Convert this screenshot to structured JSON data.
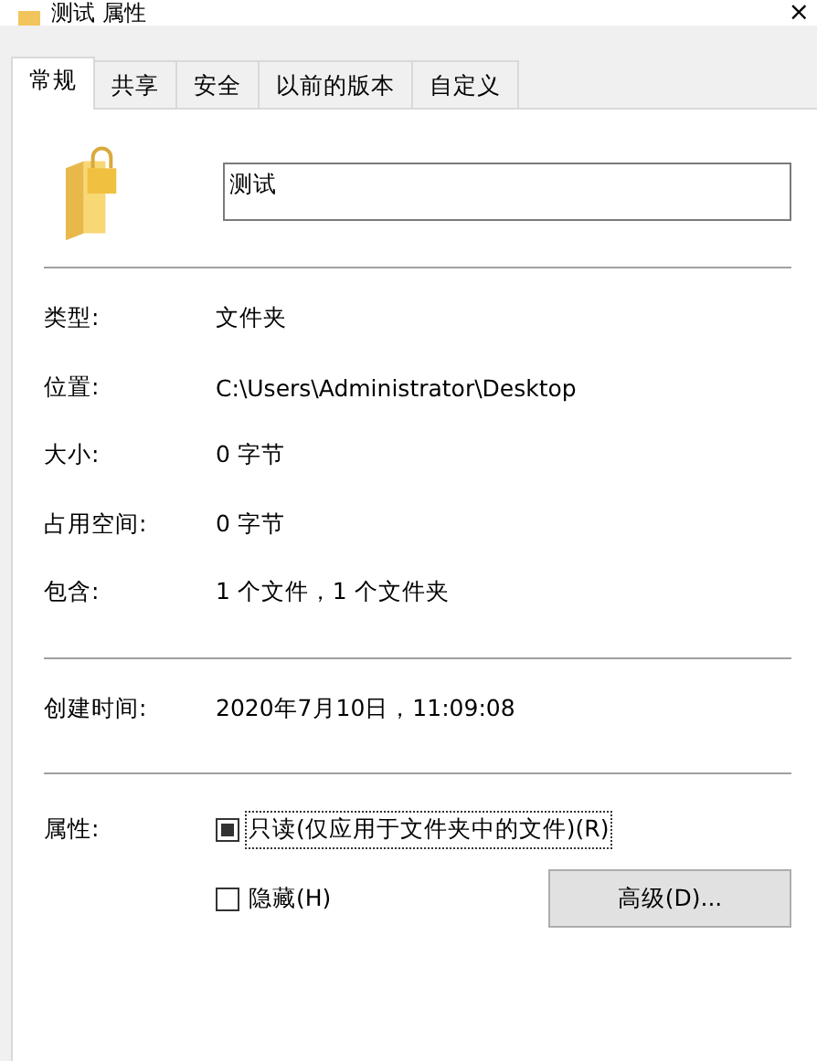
{
  "window": {
    "title": "测试 属性",
    "close": "×"
  },
  "tabs": [
    {
      "label": "常规",
      "selected": true
    },
    {
      "label": "共享",
      "selected": false
    },
    {
      "label": "安全",
      "selected": false
    },
    {
      "label": "以前的版本",
      "selected": false
    },
    {
      "label": "自定义",
      "selected": false
    }
  ],
  "name_field": {
    "value": "测试"
  },
  "info_groups": [
    [
      {
        "label": "类型:",
        "value": "文件夹"
      },
      {
        "label": "位置:",
        "value": "C:\\Users\\Administrator\\Desktop"
      },
      {
        "label": "大小:",
        "value": "0 字节"
      },
      {
        "label": "占用空间:",
        "value": "0 字节"
      },
      {
        "label": "包含:",
        "value": "1 个文件，1 个文件夹"
      }
    ],
    [
      {
        "label": "创建时间:",
        "value": "2020年7月10日，11:09:08"
      }
    ]
  ],
  "attributes": {
    "label": "属性:",
    "checkboxes": [
      {
        "label": "只读(仅应用于文件夹中的文件)(R)",
        "indeterminate": true,
        "focused": true
      },
      {
        "label": "隐藏(H)",
        "indeterminate": false,
        "focused": false
      }
    ],
    "advanced_button": "高级(D)..."
  }
}
